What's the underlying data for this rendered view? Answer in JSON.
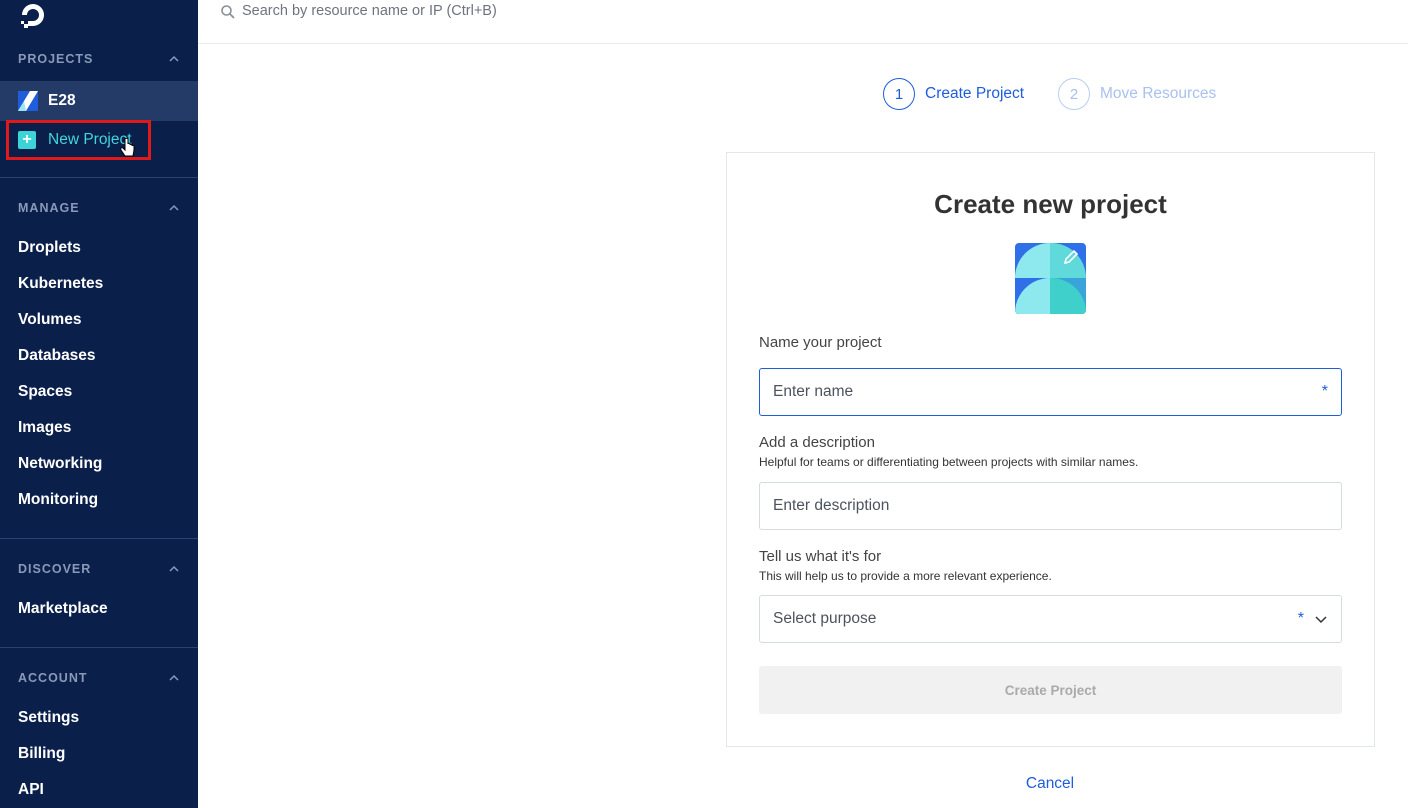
{
  "search": {
    "placeholder": "Search by resource name or IP (Ctrl+B)"
  },
  "sidebar": {
    "projects_title": "PROJECTS",
    "projects": [
      {
        "label": "E28",
        "active": true
      }
    ],
    "new_project_label": "New Project",
    "manage_title": "MANAGE",
    "manage_items": [
      "Droplets",
      "Kubernetes",
      "Volumes",
      "Databases",
      "Spaces",
      "Images",
      "Networking",
      "Monitoring"
    ],
    "discover_title": "DISCOVER",
    "discover_items": [
      "Marketplace"
    ],
    "account_title": "ACCOUNT",
    "account_items": [
      "Settings",
      "Billing",
      "API"
    ]
  },
  "stepper": {
    "steps": [
      {
        "number": "1",
        "label": "Create Project",
        "active": true
      },
      {
        "number": "2",
        "label": "Move Resources",
        "active": false
      }
    ]
  },
  "form": {
    "title": "Create new project",
    "name_label": "Name your project",
    "name_placeholder": "Enter name",
    "required_mark": "*",
    "description_label": "Add a description",
    "description_hint": "Helpful for teams or differentiating between projects with similar names.",
    "description_placeholder": "Enter description",
    "purpose_label": "Tell us what it's for",
    "purpose_hint": "This will help us to provide a more relevant experience.",
    "purpose_placeholder": "Select purpose",
    "submit_label": "Create Project",
    "cancel_label": "Cancel"
  },
  "colors": {
    "sidebar_bg": "#0b1f4b",
    "accent_blue": "#1e5ddb",
    "teal": "#3dd4d8",
    "highlight_red": "#e01a1a"
  }
}
